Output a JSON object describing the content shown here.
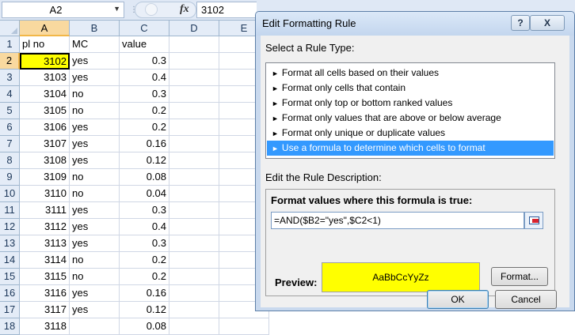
{
  "formula_bar": {
    "name_box": "A2",
    "fx_label": "fx",
    "formula": "3102"
  },
  "sheet": {
    "columns": [
      "A",
      "B",
      "C",
      "D",
      "E"
    ],
    "selected_column": "A",
    "selected_row": "2",
    "rows": [
      {
        "row": "1",
        "cells": [
          "pl no",
          "MC",
          "value"
        ]
      },
      {
        "row": "2",
        "cells": [
          "3102",
          "yes",
          "0.3"
        ]
      },
      {
        "row": "3",
        "cells": [
          "3103",
          "yes",
          "0.4"
        ]
      },
      {
        "row": "4",
        "cells": [
          "3104",
          "no",
          "0.3"
        ]
      },
      {
        "row": "5",
        "cells": [
          "3105",
          "no",
          "0.2"
        ]
      },
      {
        "row": "6",
        "cells": [
          "3106",
          "yes",
          "0.2"
        ]
      },
      {
        "row": "7",
        "cells": [
          "3107",
          "yes",
          "0.16"
        ]
      },
      {
        "row": "8",
        "cells": [
          "3108",
          "yes",
          "0.12"
        ]
      },
      {
        "row": "9",
        "cells": [
          "3109",
          "no",
          "0.08"
        ]
      },
      {
        "row": "10",
        "cells": [
          "3110",
          "no",
          "0.04"
        ]
      },
      {
        "row": "11",
        "cells": [
          "3111",
          "yes",
          "0.3"
        ]
      },
      {
        "row": "12",
        "cells": [
          "3112",
          "yes",
          "0.4"
        ]
      },
      {
        "row": "13",
        "cells": [
          "3113",
          "yes",
          "0.3"
        ]
      },
      {
        "row": "14",
        "cells": [
          "3114",
          "no",
          "0.2"
        ]
      },
      {
        "row": "15",
        "cells": [
          "3115",
          "no",
          "0.2"
        ]
      },
      {
        "row": "16",
        "cells": [
          "3116",
          "yes",
          "0.16"
        ]
      },
      {
        "row": "17",
        "cells": [
          "3117",
          "yes",
          "0.12"
        ]
      },
      {
        "row": "18",
        "cells": [
          "3118",
          "",
          "0.08"
        ]
      }
    ]
  },
  "dialog": {
    "title": "Edit Formatting Rule",
    "help_button": "?",
    "close_button": "X",
    "select_rule_label": "Select a Rule Type:",
    "rule_types": [
      {
        "label": "Format all cells based on their values",
        "selected": false
      },
      {
        "label": "Format only cells that contain",
        "selected": false
      },
      {
        "label": "Format only top or bottom ranked values",
        "selected": false
      },
      {
        "label": "Format only values that are above or below average",
        "selected": false
      },
      {
        "label": "Format only unique or duplicate values",
        "selected": false
      },
      {
        "label": "Use a formula to determine which cells to format",
        "selected": true
      }
    ],
    "rule_arrow": "►",
    "edit_description_label": "Edit the Rule Description:",
    "formula_heading": "Format values where this formula is true:",
    "formula_value": "=AND($B2=\"yes\",$C2<1)",
    "preview_label": "Preview:",
    "preview_sample": "AaBbCcYyZz",
    "preview_fill_color": "#ffff00",
    "format_button": "Format...",
    "ok_button": "OK",
    "cancel_button": "Cancel"
  }
}
